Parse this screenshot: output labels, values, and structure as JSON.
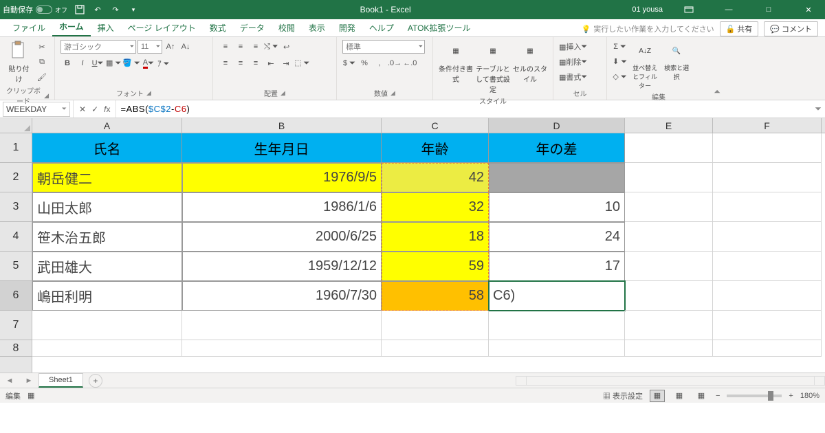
{
  "titlebar": {
    "autosave": "自動保存",
    "autosave_state": "オフ",
    "title": "Book1  -  Excel",
    "user": "01 yousa"
  },
  "tabs": {
    "file": "ファイル",
    "home": "ホーム",
    "insert": "挿入",
    "layout": "ページ レイアウト",
    "formulas": "数式",
    "data": "データ",
    "review": "校閲",
    "view": "表示",
    "dev": "開発",
    "help": "ヘルプ",
    "atok": "ATOK拡張ツール"
  },
  "tellme": "実行したい作業を入力してください",
  "share": "共有",
  "comment": "コメント",
  "ribbon": {
    "clipboard": {
      "paste": "貼り付け",
      "label": "クリップボード"
    },
    "font": {
      "name": "游ゴシック",
      "size": "11",
      "label": "フォント"
    },
    "align": {
      "label": "配置"
    },
    "number": {
      "general": "標準",
      "label": "数値"
    },
    "styles": {
      "cond": "条件付き書式",
      "table": "テーブルとして書式設定",
      "cell": "セルのスタイル",
      "label": "スタイル"
    },
    "cells": {
      "insert": "挿入",
      "delete": "削除",
      "format": "書式",
      "label": "セル"
    },
    "editing": {
      "sort": "並べ替えとフィルター",
      "find": "検索と選択",
      "label": "編集"
    }
  },
  "namebox": "WEEKDAY",
  "formula": {
    "prefix": "=ABS(",
    "ref1": "$C$2",
    "op": "-",
    "ref2": "C6",
    "suffix": ")"
  },
  "columns": [
    "A",
    "B",
    "C",
    "D",
    "E",
    "F"
  ],
  "rows": [
    "1",
    "2",
    "3",
    "4",
    "5",
    "6",
    "7",
    "8"
  ],
  "headers": {
    "A": "氏名",
    "B": "生年月日",
    "C": "年齢",
    "D": "年の差"
  },
  "data": [
    {
      "A": "朝岳健二",
      "B": "1976/9/5",
      "C": "42",
      "D": ""
    },
    {
      "A": "山田太郎",
      "B": "1986/1/6",
      "C": "32",
      "D": "10"
    },
    {
      "A": "笹木治五郎",
      "B": "2000/6/25",
      "C": "18",
      "D": "24"
    },
    {
      "A": "武田雄大",
      "B": "1959/12/12",
      "C": "59",
      "D": "17"
    },
    {
      "A": "嶋田利明",
      "B": "1960/7/30",
      "C": "58",
      "D": "C6)"
    }
  ],
  "sheet": "Sheet1",
  "status": {
    "mode": "編集",
    "display": "表示設定",
    "zoom": "180%"
  }
}
